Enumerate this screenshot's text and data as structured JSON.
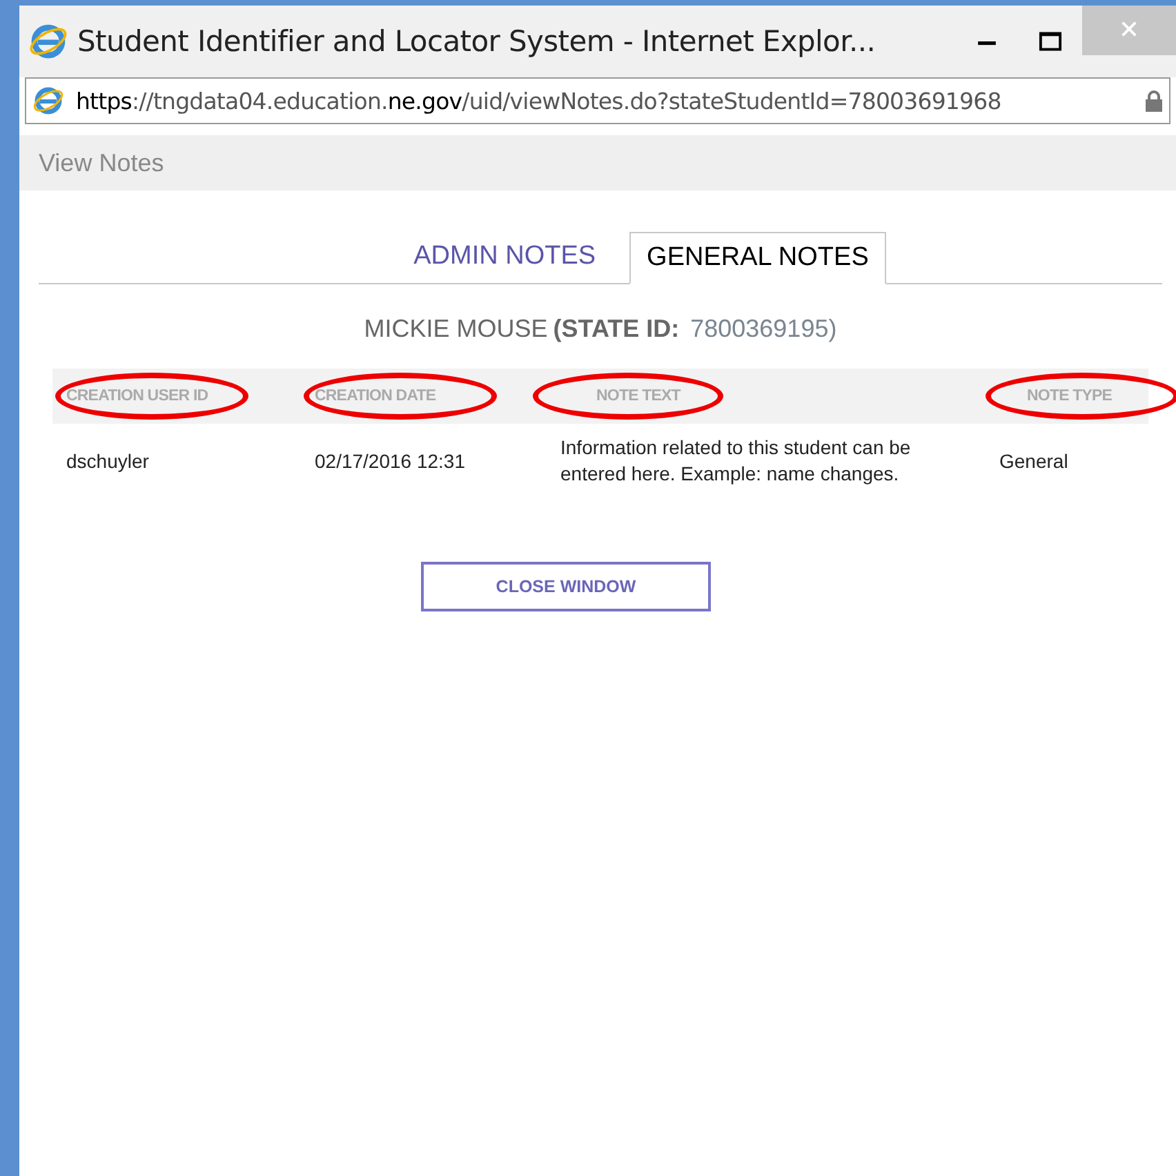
{
  "window": {
    "title": "Student Identifier and Locator System - Internet Explor..."
  },
  "address_bar": {
    "url": "**https**://tngdata04.education.**ne.gov**/uid/viewNotes.do?stateStudentId=78003691968",
    "secure": true
  },
  "page_header": "View Notes",
  "tabs": [
    {
      "label": "ADMIN NOTES",
      "selected": false
    },
    {
      "label": "GENERAL NOTES",
      "selected": true
    }
  ],
  "student": {
    "name": "MICKIE MOUSE",
    "id_label": "(STATE ID:",
    "id_value": "7800369195)"
  },
  "table": {
    "columns": [
      {
        "label": "CREATION USER ID",
        "circled": true
      },
      {
        "label": "CREATION DATE",
        "circled": true
      },
      {
        "label": "NOTE TEXT",
        "circled": true
      },
      {
        "label": "NOTE TYPE",
        "circled": true
      }
    ],
    "rows": [
      [
        "dschuyler",
        "02/17/2016 12:31",
        "Information related to this student can be entered here. Example: name changes.",
        "General"
      ]
    ]
  },
  "close_button": "CLOSE WINDOW"
}
